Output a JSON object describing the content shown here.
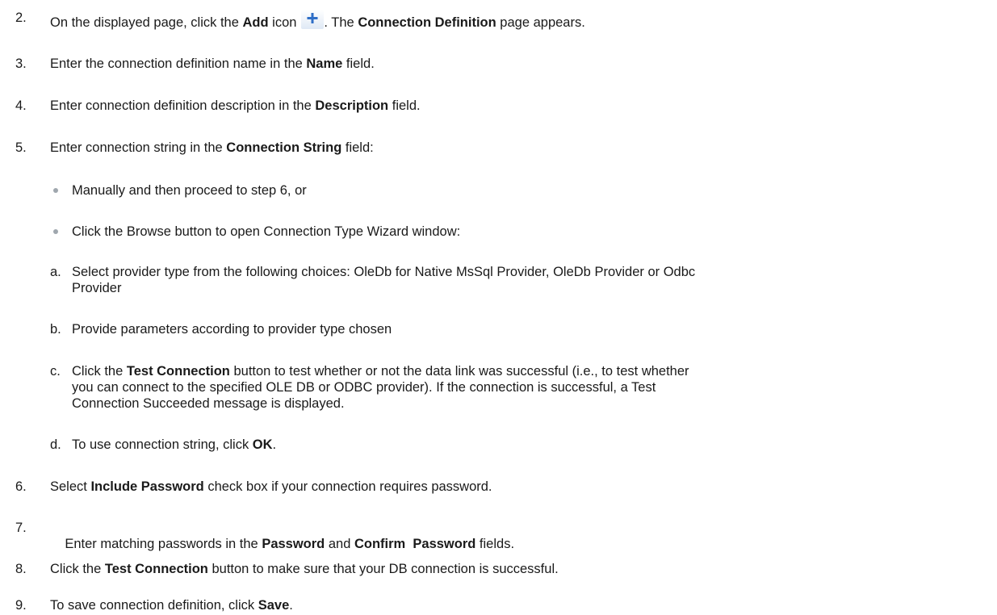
{
  "steps": [
    {
      "num": "2.",
      "parts": [
        "On the displayed page, click the ",
        "Add",
        " icon",
        ". The ",
        "Connection Definition",
        " page appears."
      ]
    },
    {
      "num": "3.",
      "parts": [
        "Enter the connection definition name in the ",
        "Name",
        " field."
      ]
    },
    {
      "num": "4.",
      "parts": [
        "Enter connection definition description in the ",
        "Description",
        " field."
      ]
    },
    {
      "num": "5.",
      "parts": [
        "Enter connection string in the ",
        "Connection String",
        " field:"
      ]
    },
    {
      "num": "6.",
      "parts": [
        "Select ",
        "Include Password",
        " check box if your connection requires password."
      ]
    },
    {
      "num": "7.",
      "parts": [
        "Enter matching passwords in the ",
        "Password",
        " and ",
        "Confirm  Password",
        " fields."
      ]
    },
    {
      "num": "8.",
      "parts": [
        "Click the ",
        "Test Connection",
        " button to make sure that your DB connection is successful."
      ]
    },
    {
      "num": "9.",
      "parts": [
        "To save connection definition, click ",
        "Save",
        "."
      ]
    }
  ],
  "bullets": [
    "Manually and then proceed to step 6, or",
    "Click the Browse button to open Connection Type Wizard window:"
  ],
  "substeps": [
    {
      "letter": "a.",
      "lines": [
        "Select provider type from the following choices: OleDb for Native MsSql Provider, OleDb Provider or Odbc",
        "Provider"
      ]
    },
    {
      "letter": "b.",
      "lines": [
        "Provide parameters according to provider type chosen"
      ]
    },
    {
      "letter": "c.",
      "pre": "Click the ",
      "bold": "Test Connection",
      "post": " button to test whether or not the data link was successful (i.e., to test whether",
      "lines": [
        "you can connect to the specified OLE DB or ODBC provider). If the connection is successful, a Test",
        "Connection Succeeded message is displayed."
      ]
    },
    {
      "letter": "d.",
      "pre": "To use connection string, click ",
      "bold": "OK",
      "post": "."
    }
  ],
  "icons": {
    "add_icon": "plus-icon",
    "add_icon_color": "#2f6fc7"
  }
}
